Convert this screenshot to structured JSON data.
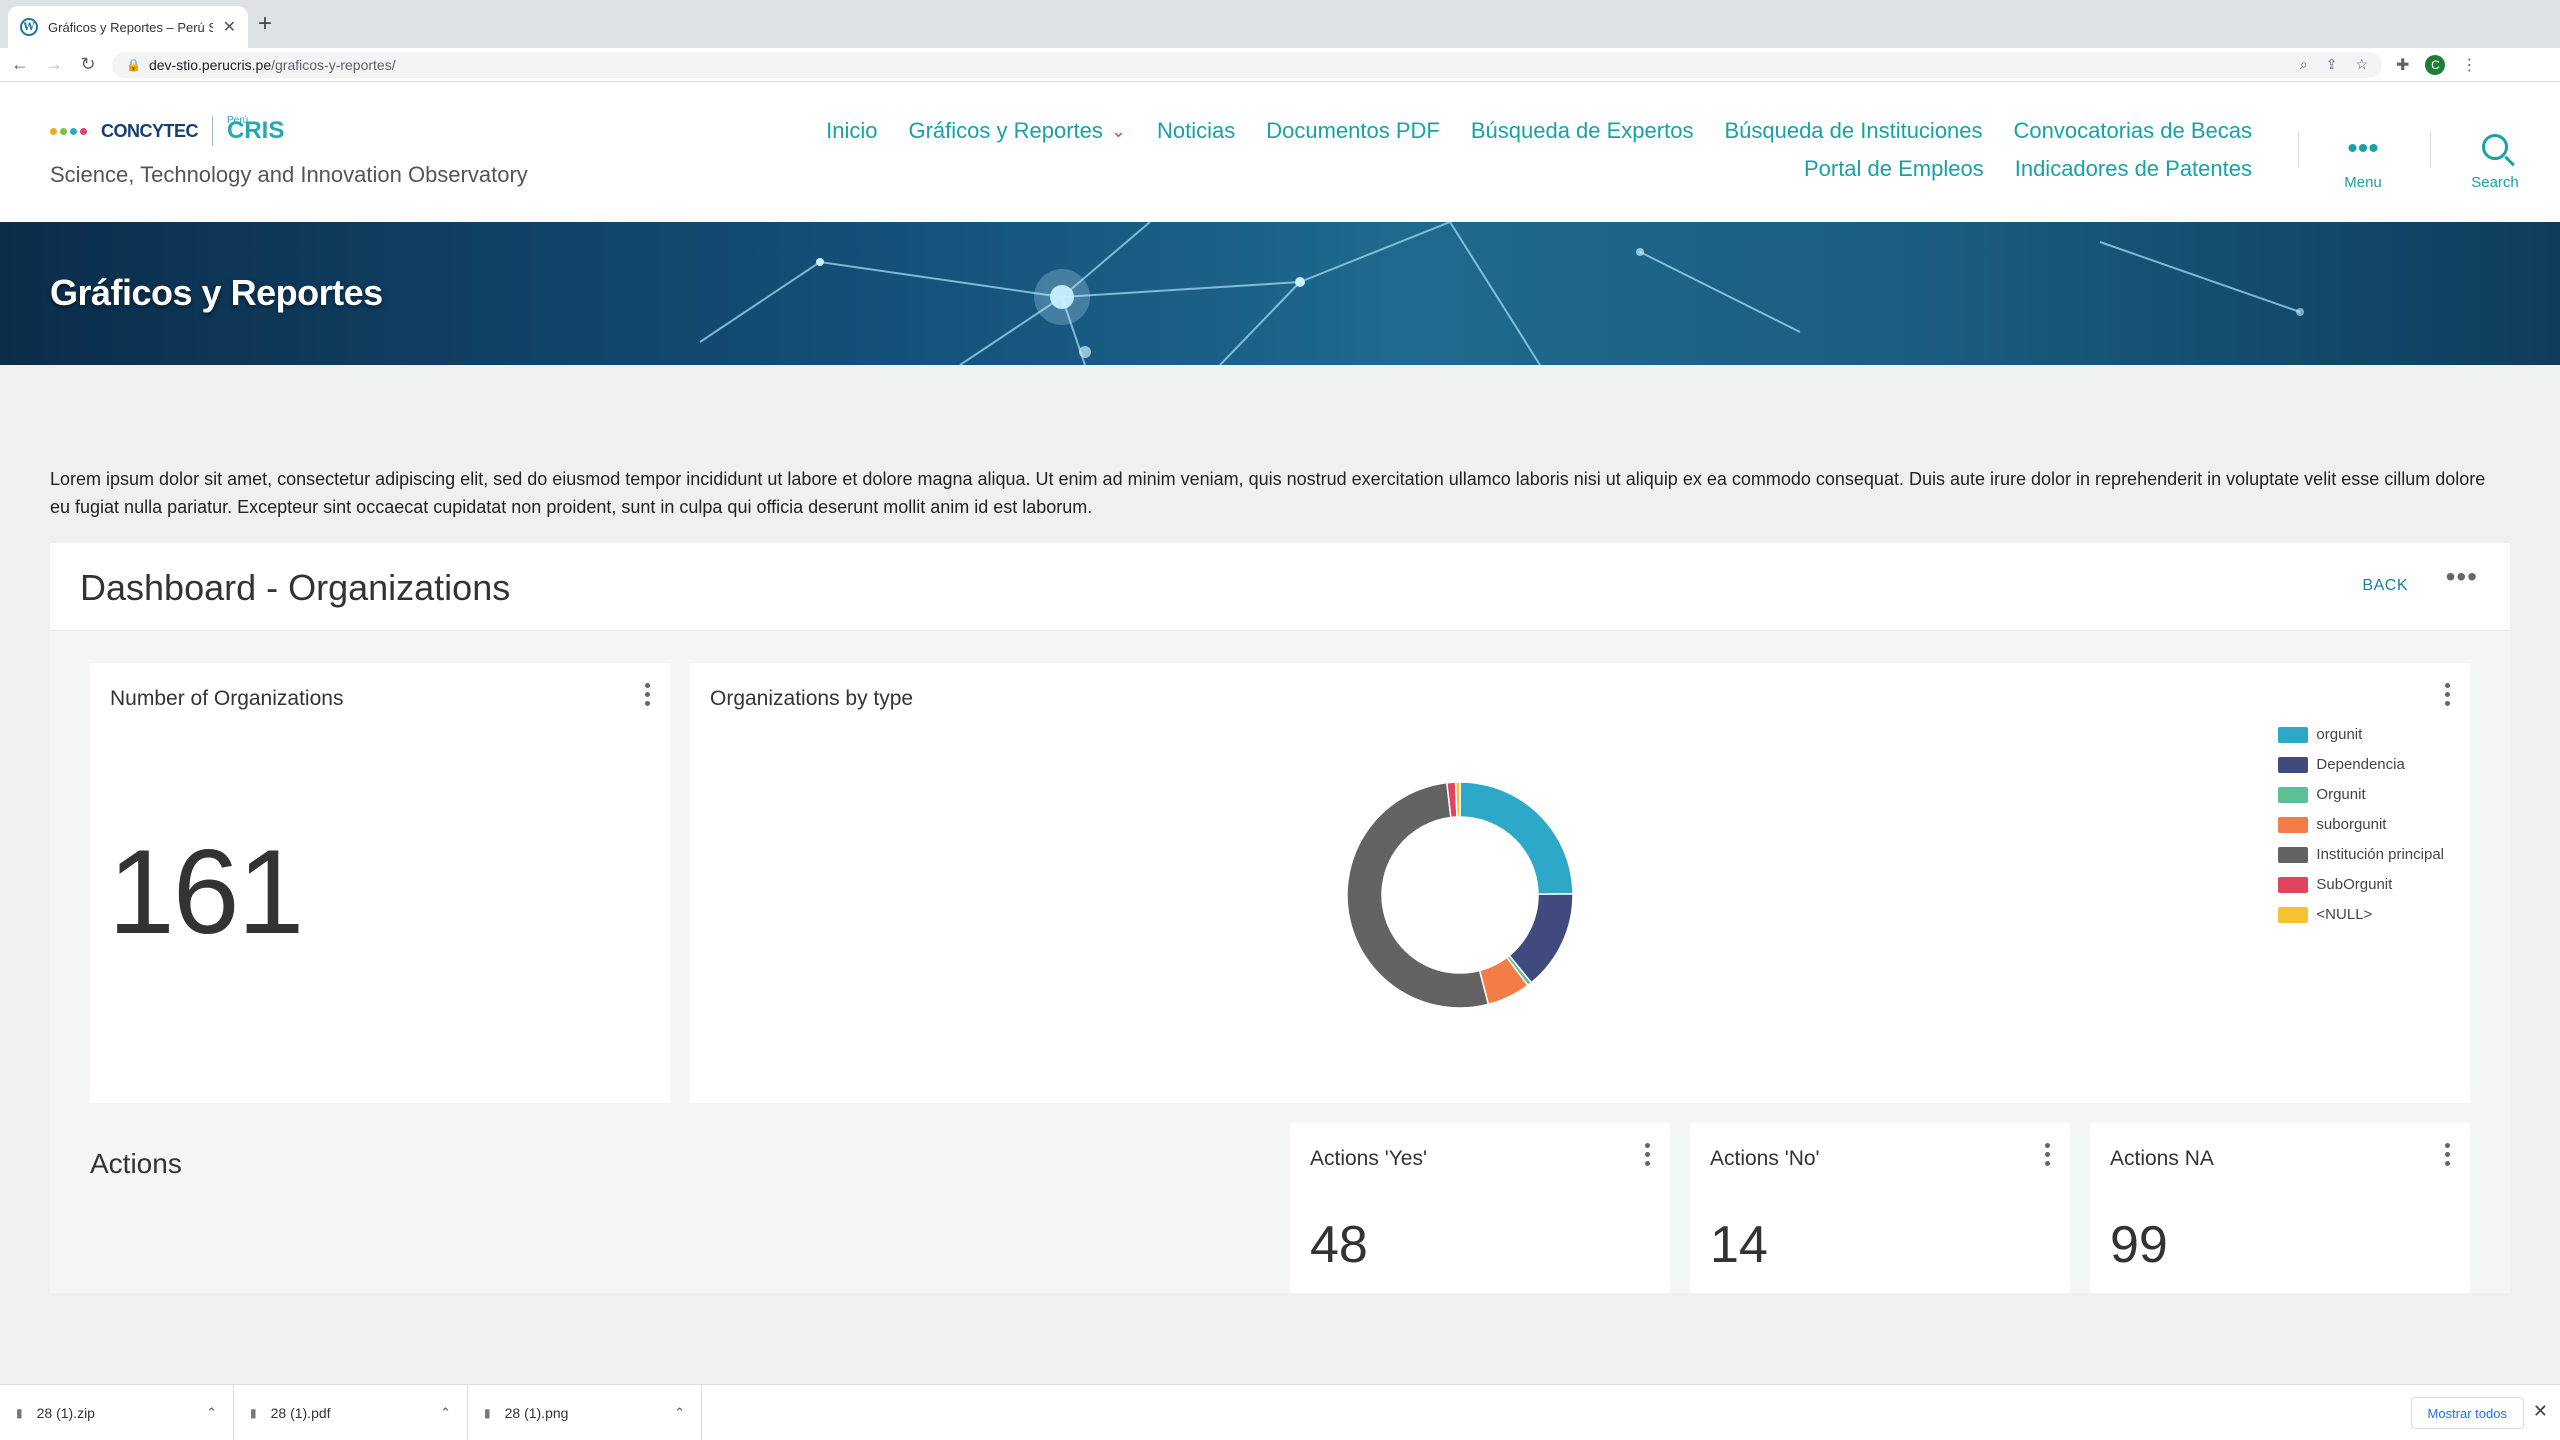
{
  "browser": {
    "tab_title": "Gráficos y Reportes – Perú STI",
    "url_host": "dev-stio.perucris.pe",
    "url_path": "/graficos-y-reportes/",
    "avatar_letter": "C"
  },
  "site": {
    "logo_org": "CONCYTEC",
    "logo_peru": "Perú",
    "logo_cris": "CRIS",
    "tagline": "Science, Technology and Innovation Observatory",
    "nav": [
      {
        "label": "Inicio"
      },
      {
        "label": "Gráficos y Reportes",
        "has_dropdown": true
      },
      {
        "label": "Noticias"
      },
      {
        "label": "Documentos PDF"
      },
      {
        "label": "Búsqueda de Expertos"
      },
      {
        "label": "Búsqueda de Instituciones"
      },
      {
        "label": "Convocatorias de Becas"
      },
      {
        "label": "Portal de Empleos"
      },
      {
        "label": "Indicadores de Patentes"
      }
    ],
    "menu_label": "Menu",
    "search_label": "Search"
  },
  "hero": {
    "title": "Gráficos y Reportes"
  },
  "intro": "Lorem ipsum dolor sit amet, consectetur adipiscing elit, sed do eiusmod tempor incididunt ut labore et dolore magna aliqua. Ut enim ad minim veniam, quis nostrud exercitation ullamco laboris nisi ut aliquip ex ea commodo consequat. Duis aute irure dolor in reprehenderit in voluptate velit esse cillum dolore eu fugiat nulla pariatur. Excepteur sint occaecat cupidatat non proident, sunt in culpa qui officia deserunt mollit anim id est laborum.",
  "dashboard": {
    "title": "Dashboard - Organizations",
    "back_label": "BACK",
    "more_label": "•••",
    "number_card": {
      "title": "Number of Organizations",
      "value": "161"
    },
    "type_card": {
      "title": "Organizations by type"
    },
    "actions_label": "Actions",
    "actions_yes": {
      "title": "Actions 'Yes'",
      "value": "48"
    },
    "actions_no": {
      "title": "Actions 'No'",
      "value": "14"
    },
    "actions_na": {
      "title": "Actions NA",
      "value": "99"
    }
  },
  "chart_data": {
    "type": "pie",
    "categories": [
      "orgunit",
      "Dependencia",
      "Orgunit",
      "suborgunit",
      "Institución principal",
      "SubOrgunit",
      "<NULL>"
    ],
    "values": [
      40,
      23,
      1,
      10,
      84,
      2,
      1
    ],
    "colors": [
      "#2ea8c9",
      "#414a7f",
      "#5cc095",
      "#f47c48",
      "#636363",
      "#e0445e",
      "#f5c331"
    ],
    "legend_position": "right"
  },
  "downloads": {
    "items": [
      {
        "name": "28 (1).zip"
      },
      {
        "name": "28 (1).pdf"
      },
      {
        "name": "28 (1).png"
      }
    ],
    "show_all": "Mostrar todos"
  }
}
